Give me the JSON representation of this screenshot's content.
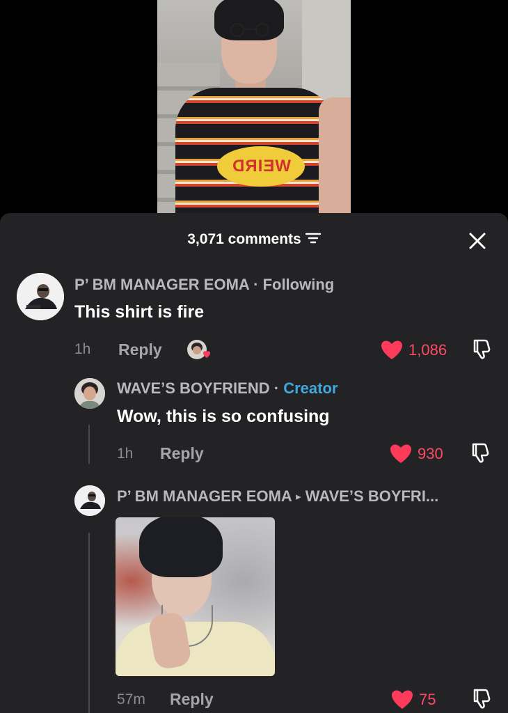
{
  "header": {
    "comments_count": "3,071 comments"
  },
  "comments": [
    {
      "author": "P’ BM MANAGER EOMA",
      "separator": "·",
      "relation": "Following",
      "text": "This shirt is fire",
      "time": "1h",
      "reply_label": "Reply",
      "likes": "1,086"
    },
    {
      "author": "WAVE’S BOYFRIEND",
      "separator": "·",
      "relation": "Creator",
      "text": "Wow, this is so confusing",
      "time": "1h",
      "reply_label": "Reply",
      "likes": "930"
    },
    {
      "author": "P’ BM MANAGER EOMA",
      "reply_to_arrow": "▸",
      "reply_to": "WAVE’S BOYFRI...",
      "time": "57m",
      "reply_label": "Reply",
      "likes": "75"
    }
  ],
  "video": {
    "shirt_logo": "WEIRD"
  },
  "colors": {
    "like": "#ff4a66",
    "creator": "#3fa8db",
    "sheet": "#232325"
  },
  "icons": [
    "sort-icon",
    "close-icon",
    "heart-icon",
    "dislike-icon",
    "creator-liked-icon"
  ]
}
